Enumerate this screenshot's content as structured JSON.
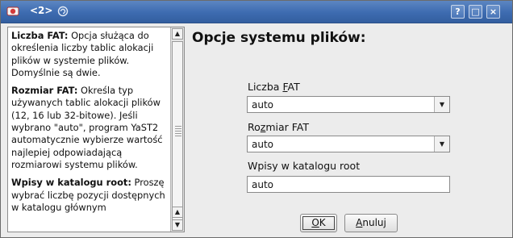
{
  "window": {
    "title": "<2>",
    "buttons": {
      "help": "?",
      "maximize": "□",
      "close": "×"
    }
  },
  "help": {
    "paragraphs": [
      {
        "term": "Liczba FAT:",
        "text": "Opcja służąca do określenia liczby tablic alokacji plików w systemie plików. Domyślnie są dwie."
      },
      {
        "term": "Rozmiar FAT:",
        "text": "Określa typ używanych tablic alokacji plików (12, 16 lub 32-bitowe). Jeśli wybrano \"auto\", program YaST2 automatycznie wybierze wartość najlepiej odpowiadającą rozmiarowi systemu plików."
      },
      {
        "term": "Wpisy w katalogu root:",
        "text": "Proszę wybrać liczbę pozycji dostępnych w katalogu głównym"
      }
    ]
  },
  "form": {
    "heading": "Opcje systemu plików:",
    "fat_count": {
      "label_pre": "Liczba ",
      "label_key": "F",
      "label_post": "AT",
      "value": "auto"
    },
    "fat_size": {
      "label_pre": "Ro",
      "label_key": "z",
      "label_post": "miar FAT",
      "value": "auto"
    },
    "root_entries": {
      "label": "Wpisy w katalogu root",
      "value": "auto"
    }
  },
  "actions": {
    "ok": {
      "key": "O",
      "rest": "K"
    },
    "cancel": {
      "key": "A",
      "rest": "nuluj"
    }
  },
  "icons": {
    "app": "yast-app-icon",
    "sticky": "sticky-swirl-icon",
    "combo_arrow": "▼",
    "scroll_up": "▲",
    "scroll_down": "▼"
  }
}
